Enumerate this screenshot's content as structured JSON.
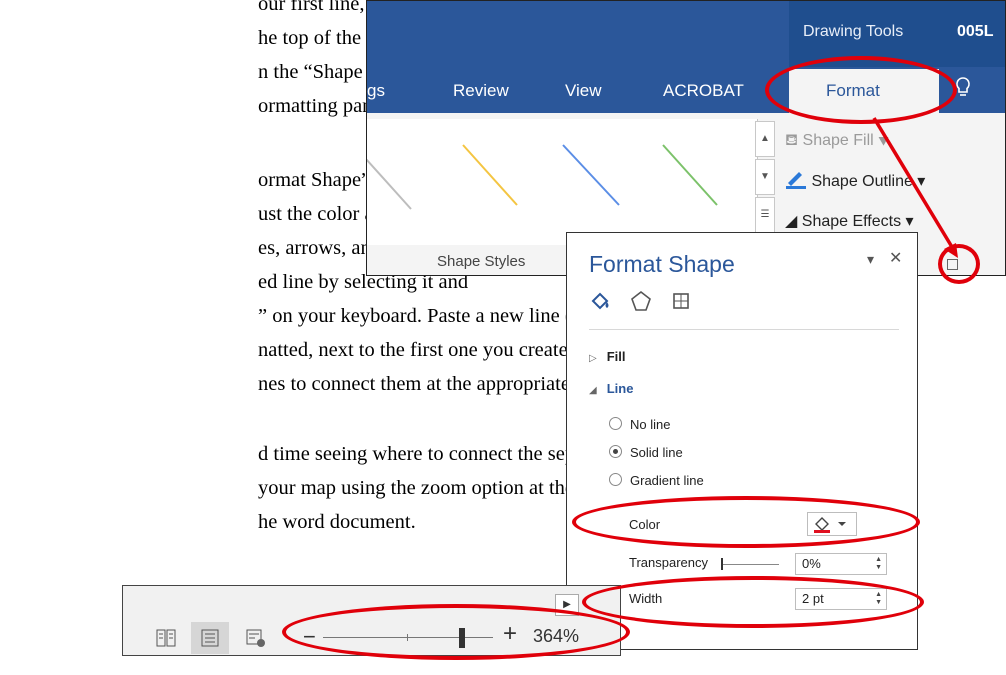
{
  "document": {
    "lines": [
      "our first line, click the",
      "he top of the page. Click the",
      "n the “Shape  Styles” section",
      "ormatting pane to the right",
      "ormat Shape” panel on the",
      "ust the color  and line width",
      "es, arrows, and shapes.",
      "ed line by selecting it and",
      "” on your keyboard. Paste a new line (“Ctrl +",
      "natted, next to the first one you created. Drag",
      "nes to connect them at the appropriate",
      "d time seeing where to connect the separate",
      " your map using the zoom option at the",
      "he word document."
    ]
  },
  "ribbon": {
    "contextual_label": "Drawing Tools",
    "document_code": "005L",
    "tabs": [
      "gs",
      "Review",
      "View",
      "ACROBAT"
    ],
    "active_tab": "Format",
    "tell_me_icon": "lightbulb-icon",
    "shape_fill": "Shape Fill",
    "shape_outline": "Shape Outline",
    "shape_effects": "Shape Effects",
    "group_label": "Shape Styles",
    "gallery_line_colors": [
      "#bdbdbd",
      "#f4c542",
      "#5b8ee6",
      "#7cc26a"
    ],
    "launcher_icon": "dialog-launcher-icon"
  },
  "format_pane": {
    "title": "Format Shape",
    "tab_icons": [
      "fill-line-icon",
      "effects-pentagon-icon",
      "size-properties-icon"
    ],
    "fill_section": "Fill",
    "line_section": "Line",
    "options": [
      "No line",
      "Solid line",
      "Gradient line"
    ],
    "selected_option": "Solid line",
    "color_label": "Color",
    "line_color": "#e01020",
    "transparency_label": "Transparency",
    "transparency_value": "0%",
    "width_label": "Width",
    "width_value": "2 pt"
  },
  "status_bar": {
    "view_icons": [
      "read-mode-icon",
      "print-layout-icon",
      "web-layout-icon"
    ],
    "active_view": "print-layout-icon",
    "zoom_minus": "−",
    "zoom_plus": "+",
    "zoom_percent": "364%"
  },
  "colors": {
    "accent": "#2b579a",
    "annotation": "#e0000a"
  }
}
